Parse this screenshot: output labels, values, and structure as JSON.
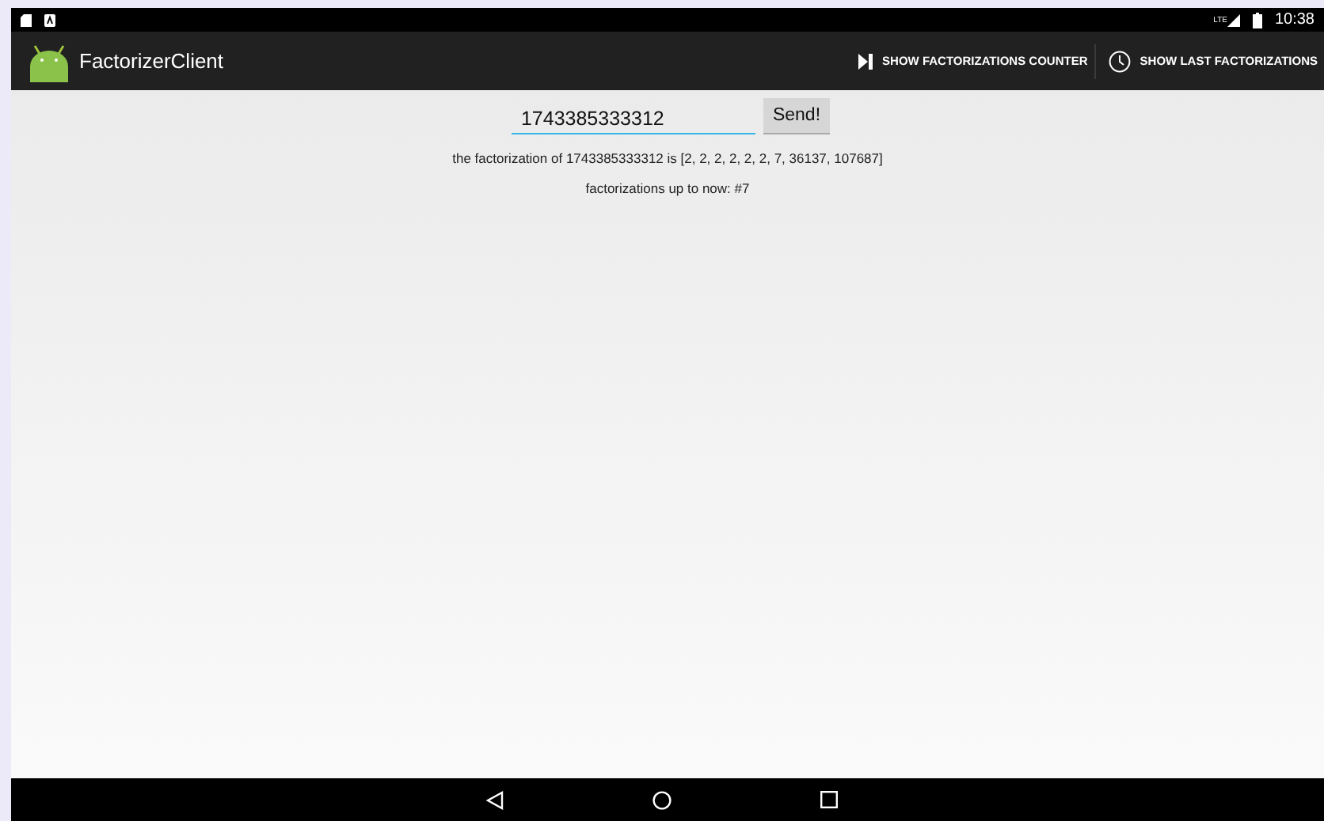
{
  "status_bar": {
    "time": "10:38",
    "network_label": "LTE"
  },
  "action_bar": {
    "title": "FactorizerClient",
    "actions": [
      {
        "kind": "counter",
        "label": "SHOW FACTORIZATIONS COUNTER"
      },
      {
        "kind": "history",
        "label": "SHOW LAST FACTORIZATIONS"
      }
    ]
  },
  "form": {
    "number_value": "1743385333312",
    "send_button": "Send!"
  },
  "result": "the factorization of 1743385333312 is [2, 2, 2, 2, 2, 2, 7, 36137, 107687]",
  "counter": "factorizations up to now: #7"
}
